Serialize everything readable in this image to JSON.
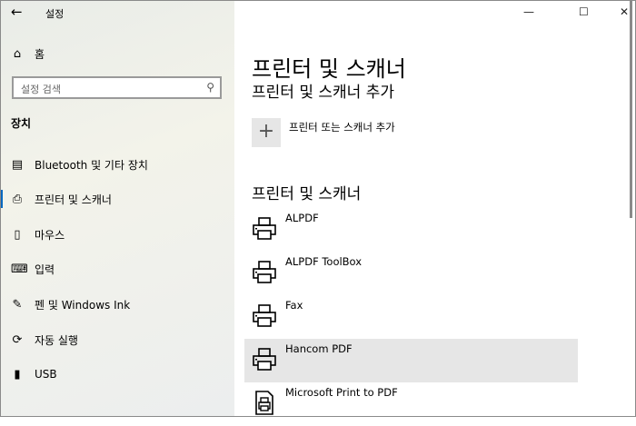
{
  "window": {
    "title": "설정",
    "back": "←",
    "minimize": "—",
    "maximize": "☐",
    "close": "✕"
  },
  "sidebar": {
    "home": "홈",
    "search_placeholder": "설정 검색",
    "section": "장치",
    "items": [
      {
        "label": "Bluetooth 및 기타 장치",
        "icon": "bluetooth-devices-icon",
        "glyph": "▤"
      },
      {
        "label": "프린터 및 스캐너",
        "icon": "printer-icon",
        "glyph": "⎙",
        "selected": true
      },
      {
        "label": "마우스",
        "icon": "mouse-icon",
        "glyph": "▯"
      },
      {
        "label": "입력",
        "icon": "keyboard-icon",
        "glyph": "⌨"
      },
      {
        "label": "펜 및 Windows Ink",
        "icon": "pen-icon",
        "glyph": "✎"
      },
      {
        "label": "자동 실행",
        "icon": "autoplay-icon",
        "glyph": "⟳"
      },
      {
        "label": "USB",
        "icon": "usb-icon",
        "glyph": "▮"
      }
    ]
  },
  "main": {
    "title": "프린터 및 스캐너",
    "add_heading": "프린터 및 스캐너 추가",
    "add_label": "프린터 또는 스캐너 추가",
    "list_heading": "프린터 및 스캐너",
    "printers": [
      "ALPDF",
      "ALPDF ToolBox",
      "Fax",
      "Hancom PDF",
      "Microsoft Print to PDF"
    ]
  },
  "colors": {
    "accent": "#0067c0",
    "hover": "#e6e6e6"
  }
}
